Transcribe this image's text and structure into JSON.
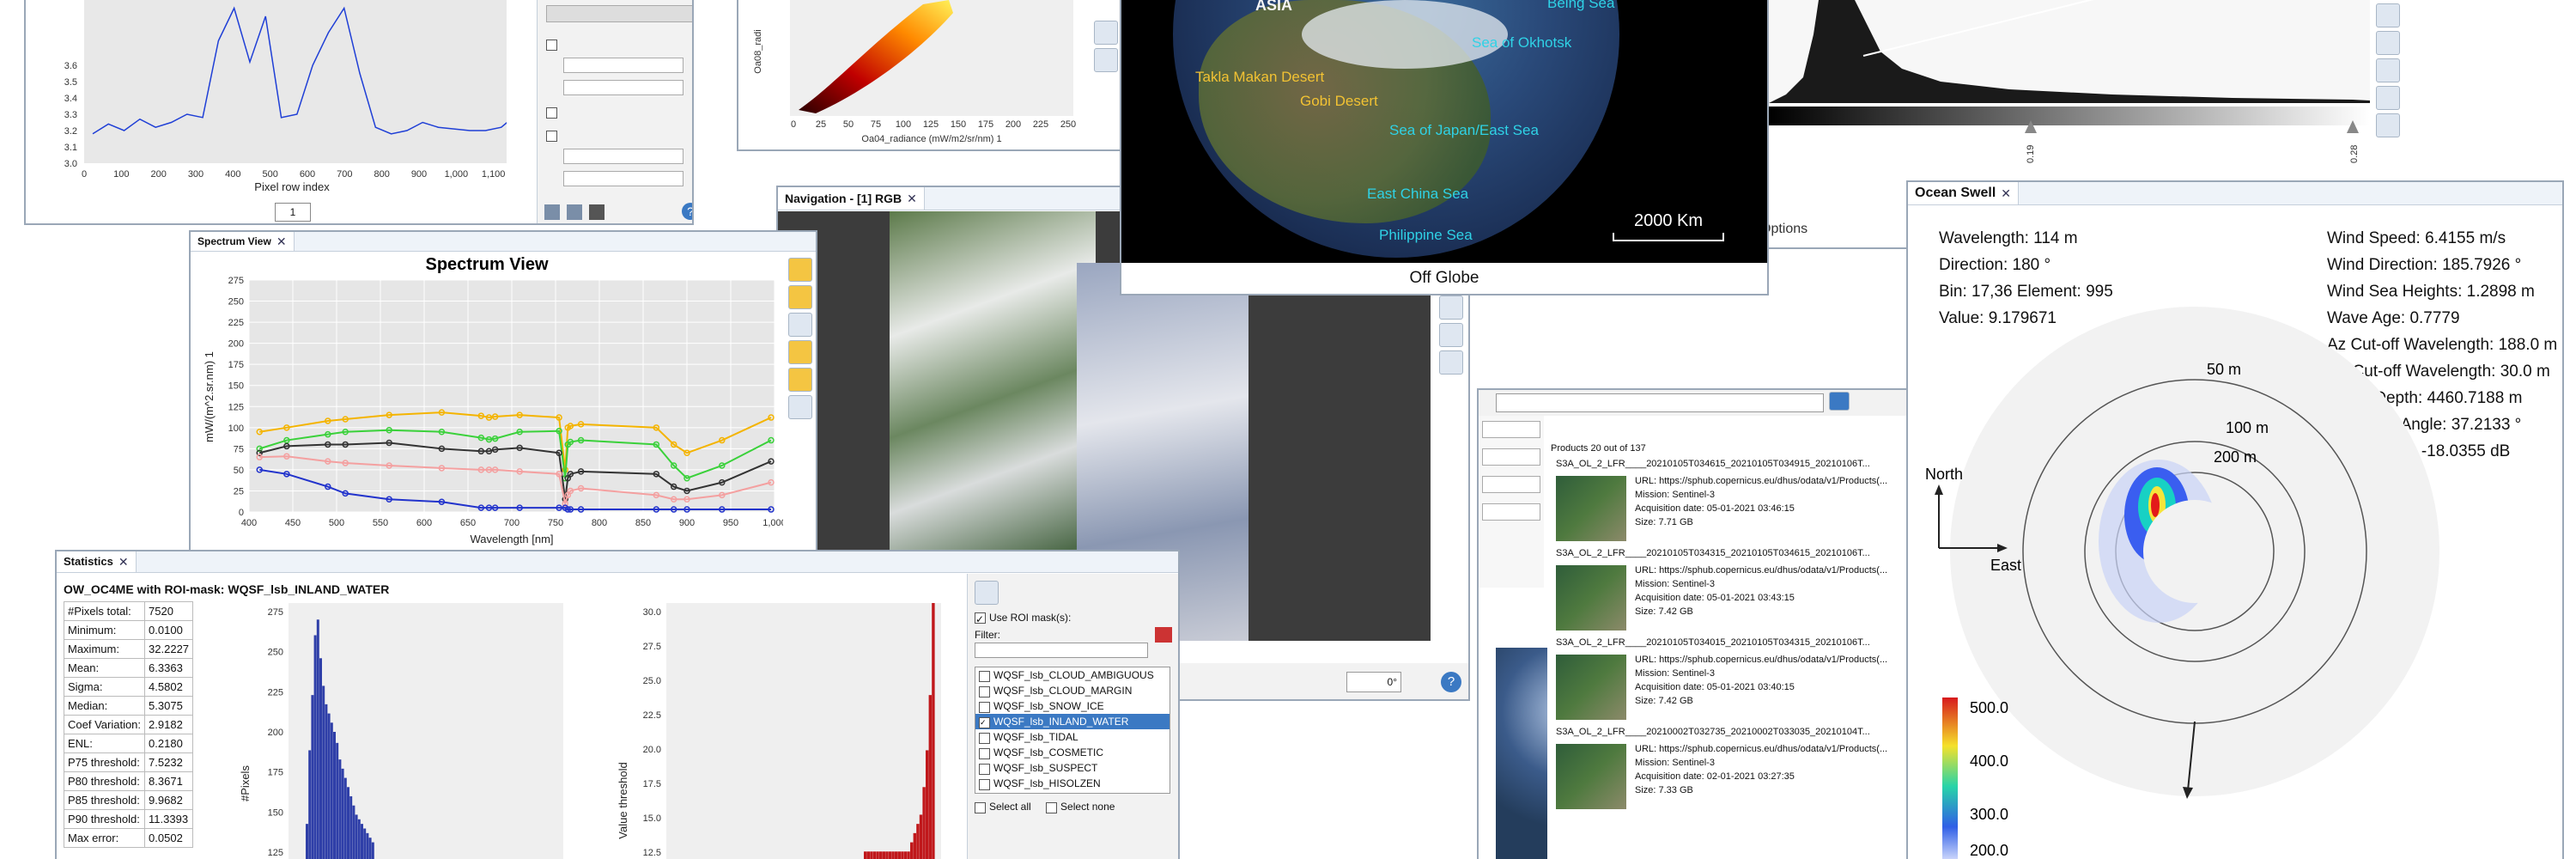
{
  "spectrum_view": {
    "tab": "Spectrum View",
    "title": "Spectrum View",
    "xlabel": "Wavelength [nm]",
    "ylabel": "mW/(m^2.sr.nm) 1",
    "x_ticks": [
      "400",
      "450",
      "500",
      "550",
      "600",
      "650",
      "700",
      "750",
      "800",
      "850",
      "900",
      "950",
      "1,000"
    ],
    "y_ticks": [
      "0",
      "25",
      "50",
      "75",
      "100",
      "125",
      "150",
      "175",
      "200",
      "225",
      "250",
      "275"
    ]
  },
  "chart_data": [
    {
      "type": "line",
      "title": "Spectrum View",
      "xlabel": "Wavelength [nm]",
      "ylabel": "mW/(m^2.sr.nm) 1",
      "xlim": [
        400,
        1000
      ],
      "ylim": [
        0,
        275
      ],
      "x": [
        412,
        443,
        490,
        510,
        560,
        620,
        665,
        674,
        681,
        709,
        754,
        761,
        764,
        767,
        779,
        865,
        885,
        900,
        940,
        1020
      ],
      "series": [
        {
          "color": "#f4b400",
          "values": [
            95,
            100,
            108,
            110,
            115,
            118,
            114,
            112,
            113,
            115,
            112,
            50,
            100,
            102,
            104,
            100,
            80,
            70,
            85,
            112
          ]
        },
        {
          "color": "#3ad13a",
          "values": [
            75,
            85,
            92,
            95,
            97,
            95,
            88,
            86,
            87,
            95,
            96,
            40,
            80,
            83,
            85,
            80,
            55,
            40,
            55,
            85
          ]
        },
        {
          "color": "#333333",
          "values": [
            70,
            78,
            80,
            80,
            82,
            75,
            72,
            72,
            74,
            76,
            70,
            15,
            40,
            45,
            48,
            45,
            30,
            25,
            35,
            60
          ]
        },
        {
          "color": "#f4a0a0",
          "values": [
            65,
            66,
            60,
            58,
            55,
            52,
            50,
            50,
            50,
            48,
            45,
            10,
            20,
            25,
            28,
            20,
            15,
            15,
            20,
            35
          ]
        },
        {
          "color": "#2233cc",
          "values": [
            50,
            45,
            30,
            22,
            15,
            12,
            5,
            5,
            5,
            5,
            5,
            5,
            3,
            3,
            3,
            3,
            3,
            3,
            3,
            3
          ]
        }
      ]
    },
    {
      "type": "line",
      "title": "",
      "xlabel": "Pixel row index",
      "ylabel": "",
      "ylim": [
        3.0,
        4.0
      ],
      "x_ticks": [
        "0",
        "100",
        "200",
        "300",
        "400",
        "500",
        "600",
        "700",
        "800",
        "900",
        "1,000",
        "1,100",
        "1,200"
      ],
      "y_ticks": [
        "3.0",
        "3.1",
        "3.2",
        "3.3",
        "3.4",
        "3.5",
        "3.6"
      ],
      "series": [
        {
          "color": "#1f3fd6",
          "values": [
            3.18,
            3.24,
            3.2,
            3.27,
            3.22,
            3.25,
            3.3,
            3.28,
            3.75,
            3.95,
            3.62,
            3.9,
            3.28,
            3.3,
            3.6,
            3.8,
            3.95,
            3.55,
            3.22,
            3.18,
            3.2,
            3.25,
            3.22,
            3.21,
            3.2,
            3.2,
            3.22,
            3.3
          ]
        }
      ]
    },
    {
      "type": "bar",
      "title": "",
      "xlabel": "",
      "ylabel": "#Pixels",
      "y_ticks": [
        "125",
        "150",
        "175",
        "200",
        "225",
        "250",
        "275"
      ],
      "values": [
        40,
        120,
        180,
        245,
        262,
        220,
        190,
        170,
        160,
        150,
        140,
        128,
        110,
        100,
        90,
        80,
        70,
        60,
        50,
        45,
        40,
        35,
        30,
        25,
        20
      ]
    },
    {
      "type": "bar",
      "title": "",
      "xlabel": "",
      "ylabel": "Value threshold",
      "y_ticks": [
        "12.5",
        "15.0",
        "17.5",
        "20.0",
        "22.5",
        "25.0",
        "27.5",
        "30.0"
      ],
      "values": [
        1,
        1,
        1,
        1,
        1,
        1,
        1,
        1,
        1,
        1,
        1,
        1,
        1,
        1,
        1,
        2,
        3,
        4,
        5,
        8,
        12,
        18,
        28
      ]
    }
  ],
  "profile_plot": {
    "xlabel": "Pixel row index",
    "x_ticks": [
      "0",
      "100",
      "200",
      "300",
      "400",
      "500",
      "600",
      "700",
      "800",
      "900",
      "1,000",
      "1,100",
      "1,200"
    ],
    "y_ticks": [
      "3.0",
      "3.1",
      "3.2",
      "3.3",
      "3.4",
      "3.5",
      "3.6"
    ],
    "spinner": "1"
  },
  "scatter_plot": {
    "xlabel": "Oa04_radiance (mW/m2/sr/nm) 1",
    "ylabel": "Oa08_radi",
    "x_ticks": [
      "0",
      "25",
      "50",
      "75",
      "100",
      "125",
      "150",
      "175",
      "200",
      "225",
      "250"
    ]
  },
  "globe": {
    "labels": [
      "ASIA",
      "Being Sea",
      "Sea of Okhotsk",
      "Takla Makan Desert",
      "Gobi Desert",
      "Sea of Japan/East Sea",
      "East China Sea",
      "Philippine Sea"
    ],
    "scale": "2000 Km",
    "footer": "Off Globe"
  },
  "histogram_panel": {
    "tick_left": "0.19",
    "tick_right": "0.28",
    "options_label": "Options"
  },
  "navigation": {
    "tab": "Navigation - [1] RGB",
    "zoom_value": "0°"
  },
  "statistics": {
    "tab": "Statistics",
    "heading": "OW_OC4ME with ROI-mask: WQSF_lsb_INLAND_WATER",
    "rows": [
      {
        "k": "#Pixels total:",
        "v": "7520"
      },
      {
        "k": "Minimum:",
        "v": "0.0100"
      },
      {
        "k": "Maximum:",
        "v": "32.2227"
      },
      {
        "k": "Mean:",
        "v": "6.3363"
      },
      {
        "k": "Sigma:",
        "v": "4.5802"
      },
      {
        "k": "Median:",
        "v": "5.3075"
      },
      {
        "k": "Coef Variation:",
        "v": "2.9182"
      },
      {
        "k": "ENL:",
        "v": "0.2180"
      },
      {
        "k": "P75 threshold:",
        "v": "7.5232"
      },
      {
        "k": "P80 threshold:",
        "v": "8.3671"
      },
      {
        "k": "P85 threshold:",
        "v": "9.9682"
      },
      {
        "k": "P90 threshold:",
        "v": "11.3393"
      },
      {
        "k": "Max error:",
        "v": "0.0502"
      }
    ],
    "hist_ylabel": "#Pixels",
    "hist_yticks": [
      "125",
      "150",
      "175",
      "200",
      "225",
      "250",
      "275"
    ],
    "thresh_ylabel": "Value threshold",
    "thresh_yticks": [
      "12.5",
      "15.0",
      "17.5",
      "20.0",
      "22.5",
      "25.0",
      "27.5",
      "30.0"
    ],
    "use_roi_label": "Use ROI mask(s):",
    "filter_label": "Filter:",
    "masks": [
      "WQSF_lsb_CLOUD_AMBIGUOUS",
      "WQSF_lsb_CLOUD_MARGIN",
      "WQSF_lsb_SNOW_ICE",
      "WQSF_lsb_INLAND_WATER",
      "WQSF_lsb_TIDAL",
      "WQSF_lsb_COSMETIC",
      "WQSF_lsb_SUSPECT",
      "WQSF_lsb_HISOLZEN"
    ],
    "select_all": "Select all",
    "select_none": "Select none"
  },
  "ocean_swell": {
    "tab": "Ocean Swell",
    "left": [
      "Wavelength: 114 m",
      "Direction: 180 °",
      "Bin: 17,36 Element: 995",
      "Value: 9.179671"
    ],
    "right": [
      "Wind Speed: 6.4155 m/s",
      "Wind Direction: 185.7926 °",
      "Wind Sea Heights: 1.2898 m",
      "Wave Age: 0.7779",
      "Az Cut-off Wavelength: 188.0 m",
      "Ra Cut-off Wavelength: 30.0 m",
      "Water Depth: 4460.7188 m",
      "Incidence Angle: 37.2133 °",
      "Backscatter: -18.0355 dB"
    ],
    "ring_labels": [
      "50 m",
      "100 m",
      "200 m"
    ],
    "north": "North",
    "east": "East",
    "colorbar": [
      "500.0",
      "400.0",
      "300.0",
      "200.0"
    ]
  },
  "product_library": {
    "header": "Products 20 out of 137",
    "items": [
      {
        "title": "S3A_OL_2_LFR____20210105T034615_20210105T034915_20210106T...",
        "url": "URL: https://sphub.copernicus.eu/dhus/odata/v1/Products(...",
        "mission": "Mission: Sentinel-3",
        "date": "Acquisition date: 05-01-2021 03:46:15",
        "size": "Size: 7.71 GB"
      },
      {
        "title": "S3A_OL_2_LFR____20210105T034315_20210105T034615_20210106T...",
        "url": "URL: https://sphub.copernicus.eu/dhus/odata/v1/Products(...",
        "mission": "Mission: Sentinel-3",
        "date": "Acquisition date: 05-01-2021 03:43:15",
        "size": "Size: 7.42 GB"
      },
      {
        "title": "S3A_OL_2_LFR____20210105T034015_20210105T034315_20210106T...",
        "url": "URL: https://sphub.copernicus.eu/dhus/odata/v1/Products(...",
        "mission": "Mission: Sentinel-3",
        "date": "Acquisition date: 05-01-2021 03:40:15",
        "size": "Size: 7.42 GB"
      },
      {
        "title": "S3A_OL_2_LFR____20210002T032735_20210002T033035_20210104T...",
        "url": "URL: https://sphub.copernicus.eu/dhus/odata/v1/Products(...",
        "mission": "Mission: Sentinel-3",
        "date": "Acquisition date: 02-01-2021 03:27:35",
        "size": "Size: 7.33 GB"
      }
    ]
  },
  "colors": {
    "accent": "#3b79c3",
    "panel_border": "#9aa7b7",
    "tab_bg": "#eef3f9"
  }
}
